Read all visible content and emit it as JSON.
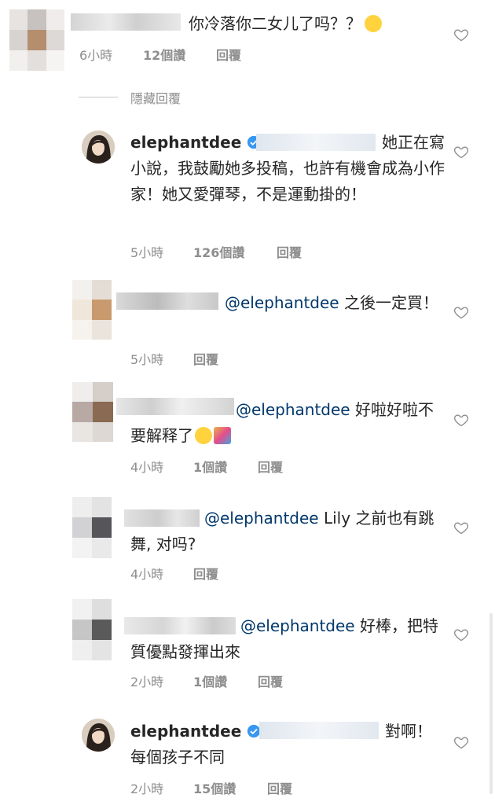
{
  "comments": [
    {
      "text": "你冷落你二女儿了吗？？",
      "time": "6小時",
      "likes": "12個讚",
      "reply": "回覆"
    },
    {
      "text": "她正在寫小說，我鼓勵她多投稿，也許有機會成為小作家！她又愛彈琴，不是運動掛的！",
      "time": "5小時",
      "likes": "126個讚",
      "reply": "回覆",
      "username": "elephantdee"
    },
    {
      "mention": "@elephantdee",
      "text": "之後一定買！",
      "time": "5小時",
      "reply": "回覆"
    },
    {
      "mention": "@elephantdee",
      "text": "好啦好啦不要解释了",
      "time": "4小時",
      "likes": "1個讚",
      "reply": "回覆"
    },
    {
      "mention": "@elephantdee",
      "text": "Lily 之前也有跳舞, 对吗?",
      "time": "4小時",
      "reply": "回覆"
    },
    {
      "mention": "@elephantdee",
      "text": "好棒，把特質優點發揮出來",
      "time": "2小時",
      "likes": "1個讚",
      "reply": "回覆"
    },
    {
      "text": "對啊！每個孩子不同",
      "time": "2小時",
      "likes": "15個讚",
      "reply": "回覆",
      "username": "elephantdee"
    }
  ],
  "hidden_replies_label": "隱藏回覆",
  "colors": {
    "mention": "#00376b",
    "meta": "#8e8e8e",
    "text": "#262626",
    "verified": "#3897f0"
  },
  "icons": {
    "heart": "heart-outline-icon",
    "verified": "verified-badge-icon",
    "emoji_laugh": "grinning-sweat-emoji-icon",
    "emoji_party": "party-popper-emoji-icon"
  }
}
